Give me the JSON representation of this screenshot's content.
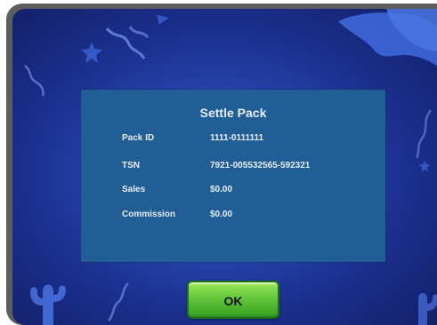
{
  "dialog": {
    "title": "Settle Pack",
    "rows": [
      {
        "label": "Pack ID",
        "value": "1111-0111111"
      },
      {
        "label": "TSN",
        "value": "7921-005532565-592321"
      },
      {
        "label": "Sales",
        "value": "$0.00"
      },
      {
        "label": "Commission",
        "value": "$0.00"
      }
    ],
    "ok_label": "OK"
  },
  "colors": {
    "background": "#2746b0",
    "panel": "#215e96",
    "panel_text": "#e6edf7",
    "button": "#5fc43a",
    "frame": "#5d5d5d"
  },
  "icons": [
    "star-icon",
    "cowboy-hat-icon",
    "cactus-icon",
    "lasso-icon"
  ]
}
